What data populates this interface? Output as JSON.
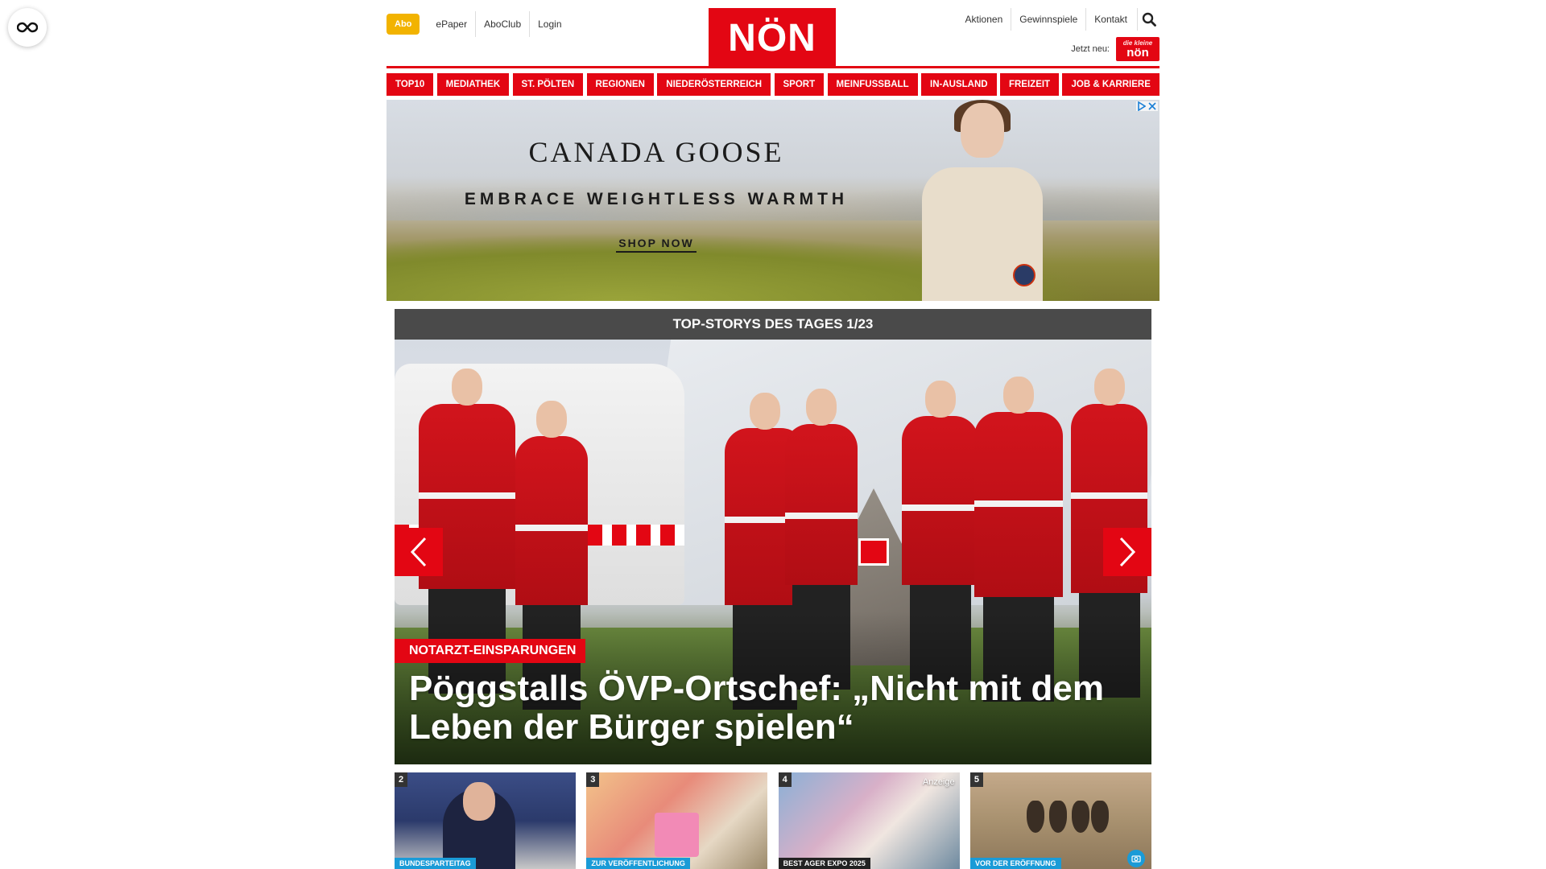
{
  "header": {
    "abo_label": "Abo",
    "top_links": [
      "ePaper",
      "AboClub",
      "Login"
    ],
    "logo_text": "NÖN",
    "right_links": [
      "Aktionen",
      "Gewinnspiele",
      "Kontakt"
    ],
    "jetzt_label": "Jetzt neu:",
    "mini_logo_top": "die kleine",
    "mini_logo_text": "nön"
  },
  "nav": {
    "items": [
      "TOP10",
      "MEDIATHEK",
      "ST. PÖLTEN",
      "REGIONEN",
      "NIEDERÖSTERREICH",
      "SPORT",
      "MEINFUSSBALL",
      "IN-AUSLAND",
      "FREIZEIT",
      "JOB & KARRIERE"
    ]
  },
  "ad": {
    "brand": "CANADA GOOSE",
    "tagline": "EMBRACE WEIGHTLESS WARMTH",
    "cta": "SHOP NOW",
    "adchoices_icon": "play-triangle-icon",
    "close_icon": "close-icon"
  },
  "top_stories": {
    "heading": "TOP-STORYS DES TAGES 1/23",
    "hero": {
      "kicker": "NOTARZT-EINSPARUNGEN",
      "title": "Pöggstalls ÖVP-Ortschef: „Nicht mit dem Leben der Bürger spielen“"
    },
    "thumbs": [
      {
        "num": "2",
        "tag": "BUNDESPARTEITAG",
        "tag_color": "#1a9bd7",
        "anzeige": ""
      },
      {
        "num": "3",
        "tag": "ZUR VERÖFFENTLICHUNG",
        "tag_color": "#1a9bd7",
        "anzeige": ""
      },
      {
        "num": "4",
        "tag": "BEST AGER EXPO 2025",
        "tag_color": "#222222",
        "anzeige": "Anzeige"
      },
      {
        "num": "5",
        "tag": "VOR DER ERÖFFNUNG",
        "tag_color": "#1a9bd7",
        "anzeige": ""
      }
    ]
  },
  "colors": {
    "brand_red": "#e30613",
    "abo_yellow": "#f2b300",
    "topstory_header": "#4a4a4a",
    "tag_blue": "#1a9bd7"
  },
  "icons": {
    "float_button": "infinity-icon",
    "search": "search-icon",
    "prev": "chevron-left-icon",
    "next": "chevron-right-icon",
    "camera": "camera-icon"
  }
}
